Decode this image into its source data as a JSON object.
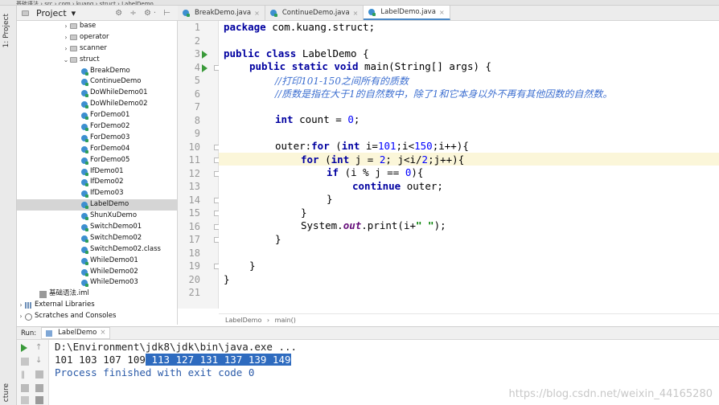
{
  "project_panel": {
    "title": "Project"
  },
  "tree": [
    {
      "label": "base",
      "type": "folder",
      "indent": 56,
      "chev": "›"
    },
    {
      "label": "operator",
      "type": "folder",
      "indent": 56,
      "chev": "›"
    },
    {
      "label": "scanner",
      "type": "folder",
      "indent": 56,
      "chev": "›"
    },
    {
      "label": "struct",
      "type": "folder",
      "indent": 56,
      "chev": "⌄"
    },
    {
      "label": "BreakDemo",
      "type": "class",
      "indent": 80
    },
    {
      "label": "ContinueDemo",
      "type": "class",
      "indent": 80
    },
    {
      "label": "DoWhileDemo01",
      "type": "class",
      "indent": 80
    },
    {
      "label": "DoWhileDemo02",
      "type": "class",
      "indent": 80
    },
    {
      "label": "ForDemo01",
      "type": "class",
      "indent": 80
    },
    {
      "label": "ForDemo02",
      "type": "class",
      "indent": 80
    },
    {
      "label": "ForDemo03",
      "type": "class",
      "indent": 80
    },
    {
      "label": "ForDemo04",
      "type": "class",
      "indent": 80
    },
    {
      "label": "ForDemo05",
      "type": "class",
      "indent": 80
    },
    {
      "label": "IfDemo01",
      "type": "class",
      "indent": 80
    },
    {
      "label": "IfDemo02",
      "type": "class",
      "indent": 80
    },
    {
      "label": "IfDemo03",
      "type": "class",
      "indent": 80
    },
    {
      "label": "LabelDemo",
      "type": "class",
      "indent": 80,
      "selected": true
    },
    {
      "label": "ShunXuDemo",
      "type": "class",
      "indent": 80
    },
    {
      "label": "SwitchDemo01",
      "type": "class",
      "indent": 80
    },
    {
      "label": "SwitchDemo02",
      "type": "class",
      "indent": 80
    },
    {
      "label": "SwitchDemo02.class",
      "type": "class",
      "indent": 80
    },
    {
      "label": "WhileDemo01",
      "type": "class",
      "indent": 80
    },
    {
      "label": "WhileDemo02",
      "type": "class",
      "indent": 80
    },
    {
      "label": "WhileDemo03",
      "type": "class",
      "indent": 80
    },
    {
      "label": "基础语法.iml",
      "type": "iml",
      "indent": 28
    },
    {
      "label": "External Libraries",
      "type": "lib",
      "indent": 0,
      "chev": "›"
    },
    {
      "label": "Scratches and Consoles",
      "type": "scratch",
      "indent": 0,
      "chev": "›"
    }
  ],
  "tabs": [
    {
      "label": "BreakDemo.java",
      "active": false
    },
    {
      "label": "ContinueDemo.java",
      "active": false
    },
    {
      "label": "LabelDemo.java",
      "active": true
    }
  ],
  "code": {
    "line1_kw": "package",
    "line1_rest": " com.kuang.struct;",
    "line3_kw1": "public",
    "line3_kw2": "class",
    "line3_name": " LabelDemo {",
    "line4_kw1": "public",
    "line4_kw2": "static",
    "line4_kw3": "void",
    "line4_rest": " main(String[] args) {",
    "line5": "//打印101-150之间所有的质数",
    "line6": "//质数是指在大于1的自然数中，除了1和它本身以外不再有其他因数的自然数。",
    "line8_kw": "int",
    "line8_rest": " count = ",
    "line8_num": "0",
    "line8_end": ";",
    "line10_a": "outer:",
    "line10_kw": "for",
    "line10_b": " (",
    "line10_kw2": "int",
    "line10_c": " i=",
    "line10_num1": "101",
    "line10_d": ";i<",
    "line10_num2": "150",
    "line10_e": ";i++){",
    "line11_kw": "for",
    "line11_a": " (",
    "line11_kw2": "int",
    "line11_b": " j = ",
    "line11_num1": "2",
    "line11_c": "; j<i/",
    "line11_num2": "2",
    "line11_d": ";j++){",
    "line12_kw": "if",
    "line12_a": " (i % j == ",
    "line12_num": "0",
    "line12_b": "){",
    "line13_kw": "continue",
    "line13_rest": " outer;",
    "line14": "}",
    "line15": "}",
    "line16_a": "System.",
    "line16_st": "out",
    "line16_b": ".print(i+",
    "line16_str": "\" \"",
    "line16_c": ");",
    "line17": "}",
    "line19": "}",
    "line20": "}"
  },
  "line_numbers": [
    "1",
    "2",
    "3",
    "4",
    "5",
    "6",
    "7",
    "8",
    "9",
    "10",
    "11",
    "12",
    "13",
    "14",
    "15",
    "16",
    "17",
    "18",
    "19",
    "20",
    "21"
  ],
  "breadcrumb": {
    "class": "LabelDemo",
    "sep": "›",
    "method": "main()"
  },
  "run": {
    "label": "Run:",
    "tab": "LabelDemo"
  },
  "console": {
    "line1": "D:\\Environment\\jdk8\\jdk\\bin\\java.exe ...",
    "line2_plain": "101 103 107 109",
    "line2_selected": " 113 127 131 137 139 149",
    "line3": "Process finished with exit code 0"
  },
  "side_labels": {
    "project": "1: Project",
    "structure": "cture"
  },
  "watermark": "https://blog.csdn.net/weixin_44165280"
}
